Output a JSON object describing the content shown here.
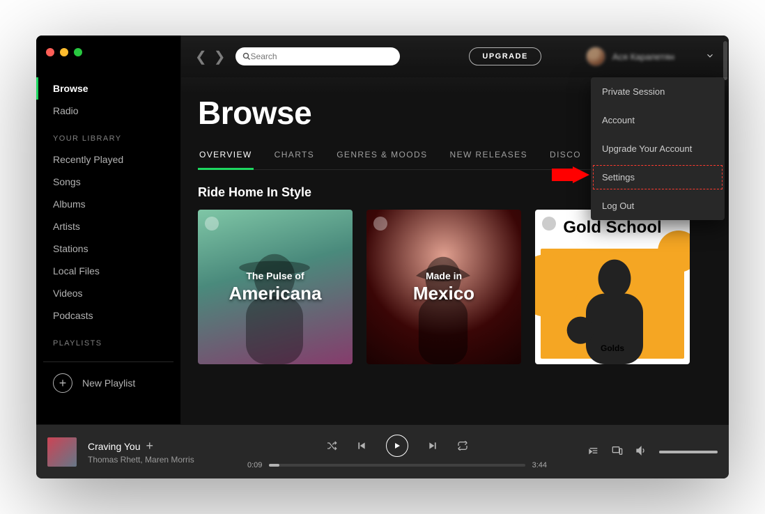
{
  "traffic_colors": {
    "close": "#ff5f57",
    "minimize": "#febc2e",
    "zoom": "#28c840"
  },
  "sidebar": {
    "main": [
      {
        "label": "Browse",
        "active": true
      },
      {
        "label": "Radio",
        "active": false
      }
    ],
    "library_heading": "YOUR LIBRARY",
    "library": [
      "Recently Played",
      "Songs",
      "Albums",
      "Artists",
      "Stations",
      "Local Files",
      "Videos",
      "Podcasts"
    ],
    "playlists_heading": "PLAYLISTS",
    "new_playlist_label": "New Playlist"
  },
  "topbar": {
    "search_placeholder": "Search",
    "upgrade_label": "UPGRADE",
    "user_name": "Ася Карапетян"
  },
  "dropdown": [
    {
      "label": "Private Session",
      "highlight": false
    },
    {
      "label": "Account",
      "highlight": false
    },
    {
      "label": "Upgrade Your Account",
      "highlight": false
    },
    {
      "label": "Settings",
      "highlight": true
    },
    {
      "label": "Log Out",
      "highlight": false
    }
  ],
  "page": {
    "title": "Browse",
    "tabs": [
      {
        "label": "OVERVIEW",
        "active": true
      },
      {
        "label": "CHARTS",
        "active": false
      },
      {
        "label": "GENRES & MOODS",
        "active": false
      },
      {
        "label": "NEW RELEASES",
        "active": false
      },
      {
        "label": "DISCO",
        "active": false
      }
    ],
    "section_heading": "Ride Home In Style",
    "cards": [
      {
        "small": "The Pulse of",
        "big": "Americana"
      },
      {
        "small": "Made in",
        "big": "Mexico"
      },
      {
        "title": "Gold School",
        "sub": "Golds"
      }
    ]
  },
  "player": {
    "track_title": "Craving You",
    "track_artist": "Thomas Rhett, Maren Morris",
    "elapsed": "0:09",
    "total": "3:44"
  }
}
